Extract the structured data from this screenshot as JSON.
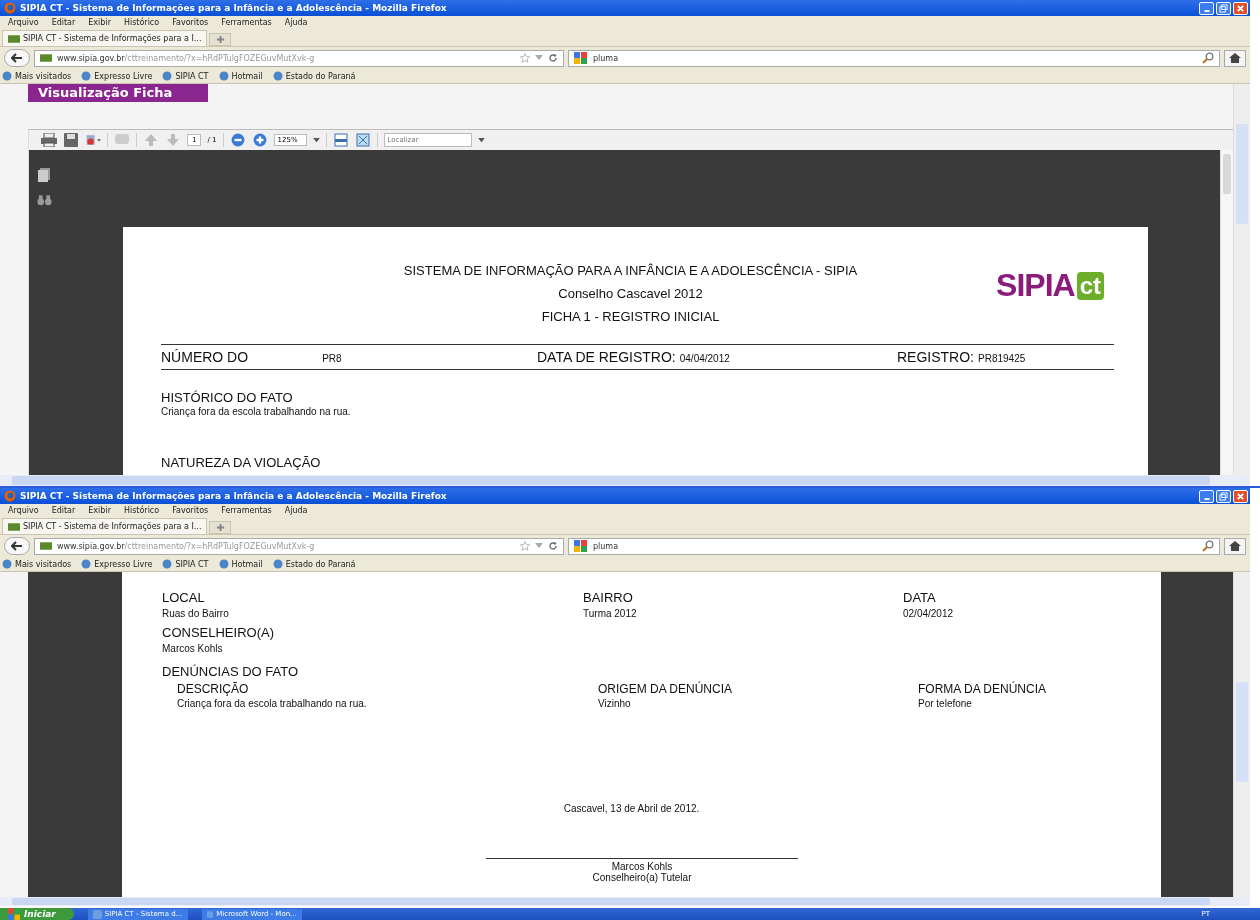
{
  "windows": [
    {
      "kind": "viewer",
      "title": "SIPIA CT - Sistema de Informações para a Infância e a Adolescência - Mozilla Firefox",
      "menu": [
        "Arquivo",
        "Editar",
        "Exibir",
        "Histórico",
        "Favoritos",
        "Ferramentas",
        "Ajuda"
      ],
      "tab": "SIPIA CT - Sistema de Informações para a I...",
      "url_host": "www.sipia.gov.br",
      "url_path": "/cttreinamento/?x=hRdPTulgFOZEGuvMutXvk-g",
      "search": "pluma",
      "bookmarks": [
        "Mais visitados",
        "Expresso Livre",
        "SIPIA CT",
        "Hotmail",
        "Estado do Paraná"
      ]
    },
    {
      "kind": "continued",
      "title": "SIPIA CT - Sistema de Informações para a Infância e a Adolescência - Mozilla Firefox",
      "menu": [
        "Arquivo",
        "Editar",
        "Exibir",
        "Histórico",
        "Favoritos",
        "Ferramentas",
        "Ajuda"
      ],
      "tab": "SIPIA CT - Sistema de Informações para a I...",
      "url_host": "www.sipia.gov.br",
      "url_path": "/cttreinamento/?x=hRdPTulgFOZEGuvMutXvk-g",
      "search": "pluma",
      "bookmarks": [
        "Mais visitados",
        "Expresso Livre",
        "SIPIA CT",
        "Hotmail",
        "Estado do Paraná"
      ]
    }
  ],
  "viewer": {
    "heading": "Visualização Ficha",
    "page": "1",
    "page_count": "/ 1",
    "zoom": "125%",
    "find_placeholder": "Localizar"
  },
  "ficha": {
    "system": "SISTEMA DE INFORMAÇÃO PARA A INFÂNCIA E A ADOLESCÊNCIA - SIPIA",
    "council": "Conselho Cascavel 2012",
    "form": "FICHA 1 - REGISTRO INICIAL",
    "logo_main": "SIPIA",
    "logo_box": "ct",
    "fields": [
      {
        "label": "NÚMERO DO",
        "value": "PR8"
      },
      {
        "label": "DATA DE REGISTRO:",
        "value": "04/04/2012"
      },
      {
        "label": "REGISTRO:",
        "value": "PR819425"
      }
    ],
    "history": {
      "heading": "HISTÓRICO DO FATO",
      "text": "Criança fora da escola trabalhando na rua."
    },
    "violation": {
      "heading": "NATUREZA DA VIOLAÇÃO"
    }
  },
  "page_2": {
    "place": [
      {
        "label": "LOCAL",
        "value": "Ruas do Bairro"
      },
      {
        "label": "BAIRRO",
        "value": "Turma 2012"
      },
      {
        "label": "DATA",
        "value": "02/04/2012"
      }
    ],
    "counselor": {
      "label": "CONSELHEIRO(A)",
      "value": "Marcos Kohls"
    },
    "complaints": {
      "heading": "DENÚNCIAS DO FATO",
      "columns": [
        {
          "label": "DESCRIÇÃO",
          "value": "Criança fora da escola trabalhando na rua."
        },
        {
          "label": "ORIGEM DA DENÚNCIA",
          "value": "Vizinho"
        },
        {
          "label": "FORMA DA DENÚNCIA",
          "value": "Por telefone"
        }
      ]
    },
    "place_date": "Cascavel, 13 de Abril de 2012.",
    "signature": {
      "name": "Marcos Kohls",
      "role": "Conselheiro(a) Tutelar"
    }
  },
  "taskbar": {
    "start": "Iniciar",
    "tasks": [
      "SIPIA CT - Sistema d...",
      "Microsoft Word - Mon..."
    ],
    "language": "PT"
  }
}
